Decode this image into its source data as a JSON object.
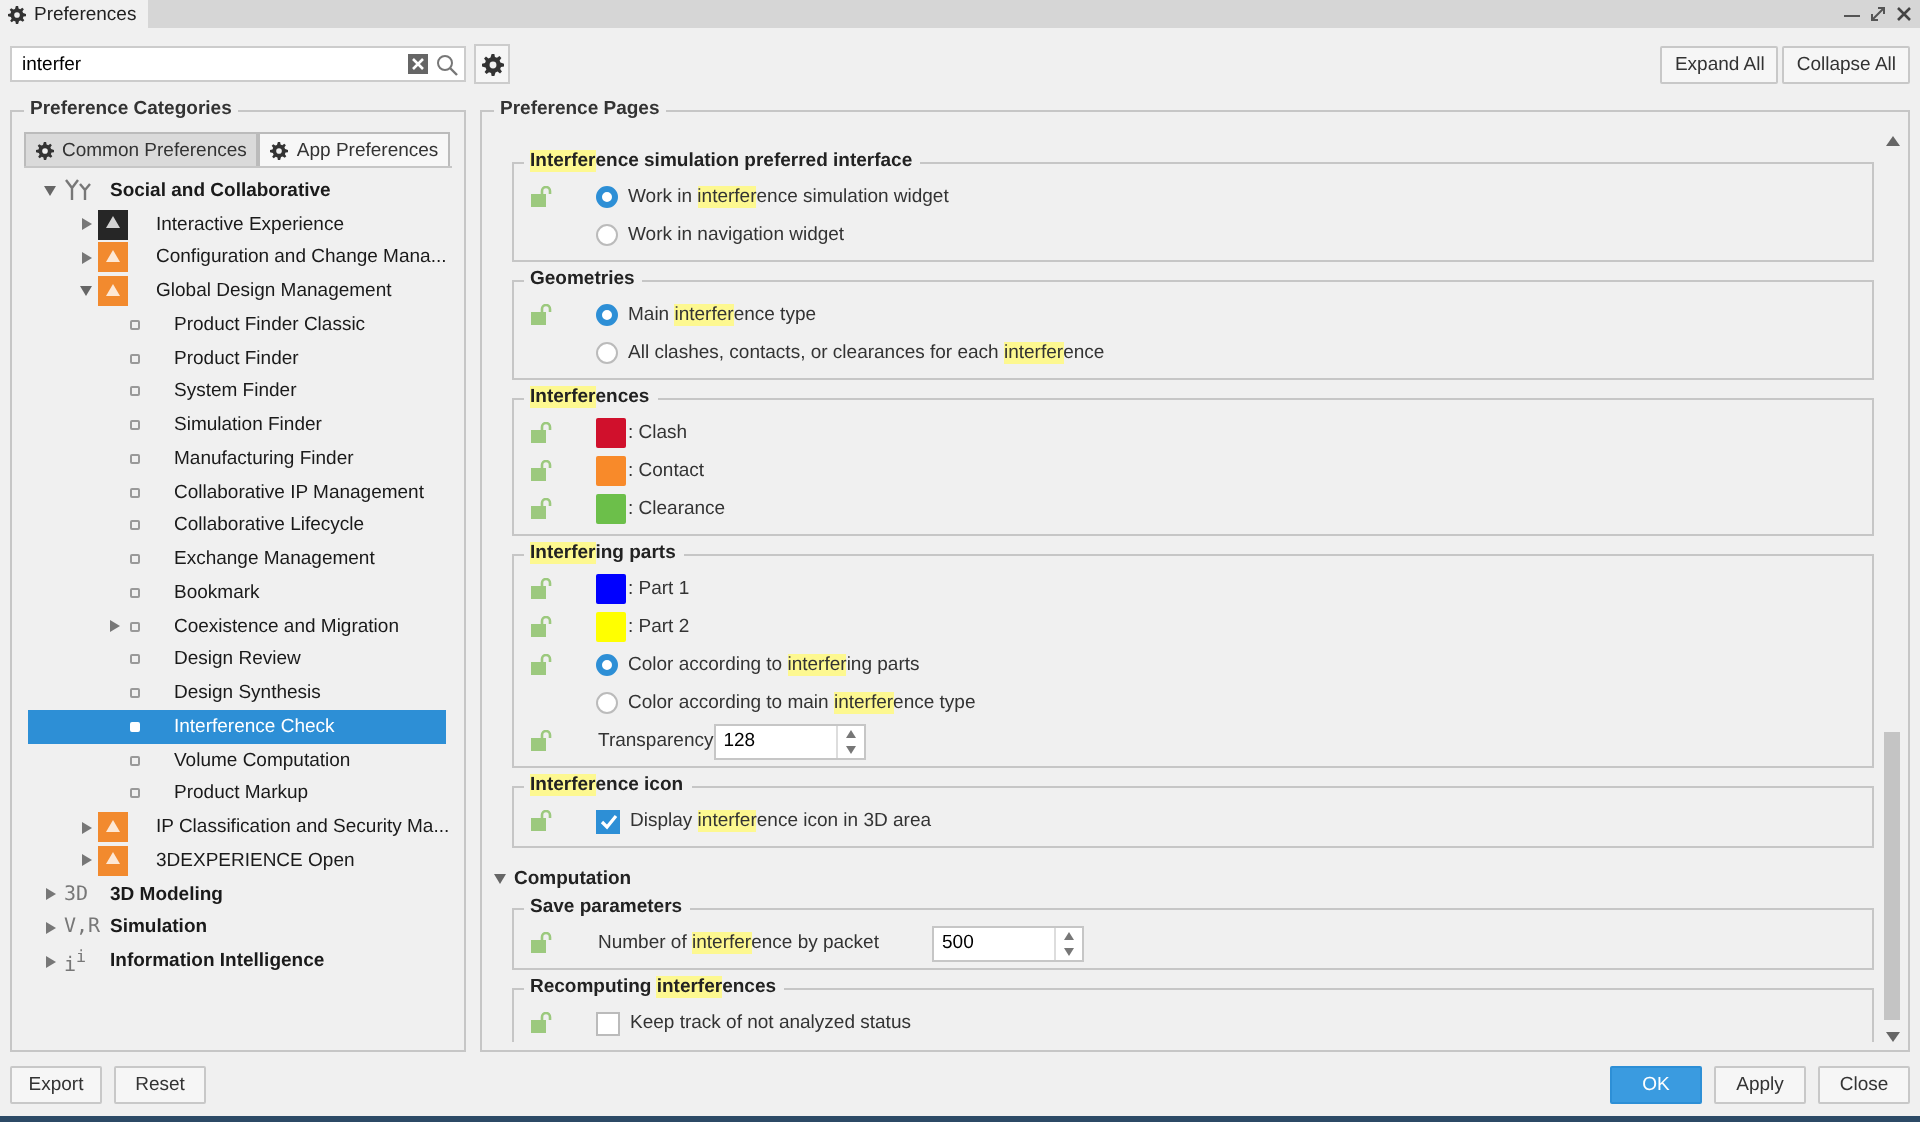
{
  "window": {
    "tab": "Preferences"
  },
  "search": {
    "value": "interfer"
  },
  "header_buttons": [
    "Expand All",
    "Collapse All"
  ],
  "categories": {
    "title": "Preference Categories",
    "tabs": [
      {
        "label": "Common Preferences",
        "selected": false
      },
      {
        "label": "App Preferences",
        "selected": true
      }
    ],
    "tree": [
      {
        "label": "Social and Collaborative",
        "expanded": true,
        "selected": false,
        "children": [
          {
            "label": "Interactive Experience",
            "color": "#262626",
            "expanded": false,
            "selected": false
          },
          {
            "label": "Configuration and Change Mana...",
            "color": "#f28a2e",
            "expanded": false,
            "selected": false
          },
          {
            "label": "Global Design Management",
            "color": "#f28a2e",
            "expanded": true,
            "selected": false,
            "children": [
              {
                "label": "Product Finder Classic",
                "selected": false
              },
              {
                "label": "Product Finder",
                "selected": false
              },
              {
                "label": "System Finder",
                "selected": false
              },
              {
                "label": "Simulation Finder",
                "selected": false
              },
              {
                "label": "Manufacturing Finder",
                "selected": false
              },
              {
                "label": "Collaborative IP Management",
                "selected": false
              },
              {
                "label": "Collaborative Lifecycle",
                "selected": false
              },
              {
                "label": "Exchange Management",
                "selected": false
              },
              {
                "label": "Bookmark",
                "selected": false
              },
              {
                "label": "Coexistence and Migration",
                "selected": false,
                "expanded": false
              },
              {
                "label": "Design Review",
                "selected": false
              },
              {
                "label": "Design Synthesis",
                "selected": false
              },
              {
                "label": "Interference Check",
                "selected": true
              },
              {
                "label": "Volume Computation",
                "selected": false
              },
              {
                "label": "Product Markup",
                "selected": false
              }
            ]
          },
          {
            "label": "IP Classification and Security Ma...",
            "color": "#f28a2e",
            "expanded": false,
            "selected": false
          },
          {
            "label": "3DEXPERIENCE Open",
            "color": "#f28a2e",
            "expanded": false,
            "selected": false
          }
        ]
      },
      {
        "label": "3D Modeling",
        "badge": "3D",
        "expanded": false,
        "selected": false
      },
      {
        "label": "Simulation",
        "badge": "V,R",
        "expanded": false,
        "selected": false
      },
      {
        "label": "Information Intelligence",
        "badge": "i$^{i}$",
        "expanded": false,
        "selected": false
      }
    ]
  },
  "pages": {
    "title": "Preference Pages",
    "sections": [
      {
        "groups": [
          {
            "title": [
              {
                "text": "Interfer",
                "highlighted": true
              },
              {
                "text": "ence simulation preferred interface",
                "highlighted": false
              }
            ],
            "rows": [
              {
                "kind": "radio",
                "lock": true,
                "selected": true,
                "label": [
                  {
                    "text": "Work in ",
                    "highlighted": false
                  },
                  {
                    "text": "interfer",
                    "highlighted": true
                  },
                  {
                    "text": "ence simulation widget",
                    "highlighted": false
                  }
                ]
              },
              {
                "kind": "radio",
                "lock": false,
                "selected": false,
                "label": [
                  {
                    "text": "Work in navigation widget",
                    "highlighted": false
                  }
                ]
              }
            ]
          },
          {
            "title": [
              {
                "text": "Geometries",
                "highlighted": false
              }
            ],
            "rows": [
              {
                "kind": "radio",
                "lock": true,
                "selected": true,
                "label": [
                  {
                    "text": "Main ",
                    "highlighted": false
                  },
                  {
                    "text": "interfer",
                    "highlighted": true
                  },
                  {
                    "text": "ence type",
                    "highlighted": false
                  }
                ]
              },
              {
                "kind": "radio",
                "lock": false,
                "selected": false,
                "label": [
                  {
                    "text": "All clashes, contacts, or clearances for each ",
                    "highlighted": false
                  },
                  {
                    "text": "interfer",
                    "highlighted": true
                  },
                  {
                    "text": "ence",
                    "highlighted": false
                  }
                ]
              }
            ]
          },
          {
            "title": [
              {
                "text": "Interfer",
                "highlighted": true
              },
              {
                "text": "ences",
                "highlighted": false
              }
            ],
            "rows": [
              {
                "kind": "color",
                "lock": true,
                "color": "#d0102c",
                "label": [
                  {
                    "text": ": Clash",
                    "highlighted": false
                  }
                ]
              },
              {
                "kind": "color",
                "lock": true,
                "color": "#f88a2a",
                "label": [
                  {
                    "text": ": Contact",
                    "highlighted": false
                  }
                ]
              },
              {
                "kind": "color",
                "lock": true,
                "color": "#6cbf4a",
                "label": [
                  {
                    "text": ": Clearance",
                    "highlighted": false
                  }
                ]
              }
            ]
          },
          {
            "title": [
              {
                "text": "Interfer",
                "highlighted": true
              },
              {
                "text": "ing parts",
                "highlighted": false
              }
            ],
            "rows": [
              {
                "kind": "color",
                "lock": true,
                "color": "#0000ff",
                "label": [
                  {
                    "text": ": Part 1",
                    "highlighted": false
                  }
                ]
              },
              {
                "kind": "color",
                "lock": true,
                "color": "#ffff00",
                "label": [
                  {
                    "text": ": Part 2",
                    "highlighted": false
                  }
                ]
              },
              {
                "kind": "radio",
                "lock": true,
                "selected": true,
                "label": [
                  {
                    "text": "Color according to ",
                    "highlighted": false
                  },
                  {
                    "text": "interfer",
                    "highlighted": true
                  },
                  {
                    "text": "ing parts",
                    "highlighted": false
                  }
                ]
              },
              {
                "kind": "radio",
                "lock": false,
                "selected": false,
                "label": [
                  {
                    "text": "Color according to main ",
                    "highlighted": false
                  },
                  {
                    "text": "interfer",
                    "highlighted": true
                  },
                  {
                    "text": "ence type",
                    "highlighted": false
                  }
                ]
              },
              {
                "kind": "spin",
                "lock": true,
                "value": "128",
                "label": [
                  {
                    "text": "Transparency",
                    "highlighted": false
                  }
                ]
              }
            ]
          },
          {
            "title": [
              {
                "text": "Interfer",
                "highlighted": true
              },
              {
                "text": "ence icon",
                "highlighted": false
              }
            ],
            "rows": [
              {
                "kind": "checkbox",
                "lock": true,
                "checked": true,
                "label": [
                  {
                    "text": "Display ",
                    "highlighted": false
                  },
                  {
                    "text": "interfer",
                    "highlighted": true
                  },
                  {
                    "text": "ence icon in 3D area",
                    "highlighted": false
                  }
                ]
              }
            ]
          }
        ]
      },
      {
        "title": "Computation",
        "expanded": true,
        "groups": [
          {
            "title": [
              {
                "text": "Save parameters",
                "highlighted": false
              }
            ],
            "rows": [
              {
                "kind": "spin",
                "lock": true,
                "value": "500",
                "label": [
                  {
                    "text": "Number of ",
                    "highlighted": false
                  },
                  {
                    "text": "interfer",
                    "highlighted": true
                  },
                  {
                    "text": "ence by packet",
                    "highlighted": false
                  }
                ]
              }
            ]
          },
          {
            "title": [
              {
                "text": "Recomputing ",
                "highlighted": false
              },
              {
                "text": "interfer",
                "highlighted": true
              },
              {
                "text": "ences",
                "highlighted": false
              }
            ],
            "rows": [
              {
                "kind": "checkbox",
                "lock": true,
                "checked": false,
                "label": [
                  {
                    "text": "Keep track of not analyzed status",
                    "highlighted": false
                  }
                ]
              }
            ]
          }
        ]
      }
    ]
  },
  "footer_left": [
    "Export",
    "Reset"
  ],
  "footer_right": [
    {
      "label": "OK",
      "primary": true
    },
    {
      "label": "Apply",
      "primary": false
    },
    {
      "label": "Close",
      "primary": false
    }
  ]
}
